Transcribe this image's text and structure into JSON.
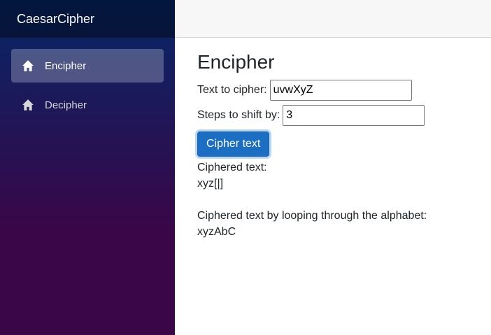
{
  "app": {
    "brand": "CaesarCipher"
  },
  "nav": {
    "items": [
      {
        "label": "Encipher",
        "icon": "home-icon",
        "active": true
      },
      {
        "label": "Decipher",
        "icon": "home-icon",
        "active": false
      }
    ]
  },
  "page": {
    "title": "Encipher",
    "text_label": "Text to cipher:",
    "text_value": "uvwXyZ",
    "steps_label": "Steps to shift by:",
    "steps_value": "3",
    "button_label": "Cipher text",
    "result_label": "Ciphered text:",
    "result_value": "xyz[|]",
    "loop_label": "Ciphered text by looping through the alphabet:",
    "loop_value": "xyzAbC"
  },
  "colors": {
    "sidebar_top": "#052767",
    "sidebar_bottom": "#3a0647",
    "button": "#1b6ec2"
  }
}
